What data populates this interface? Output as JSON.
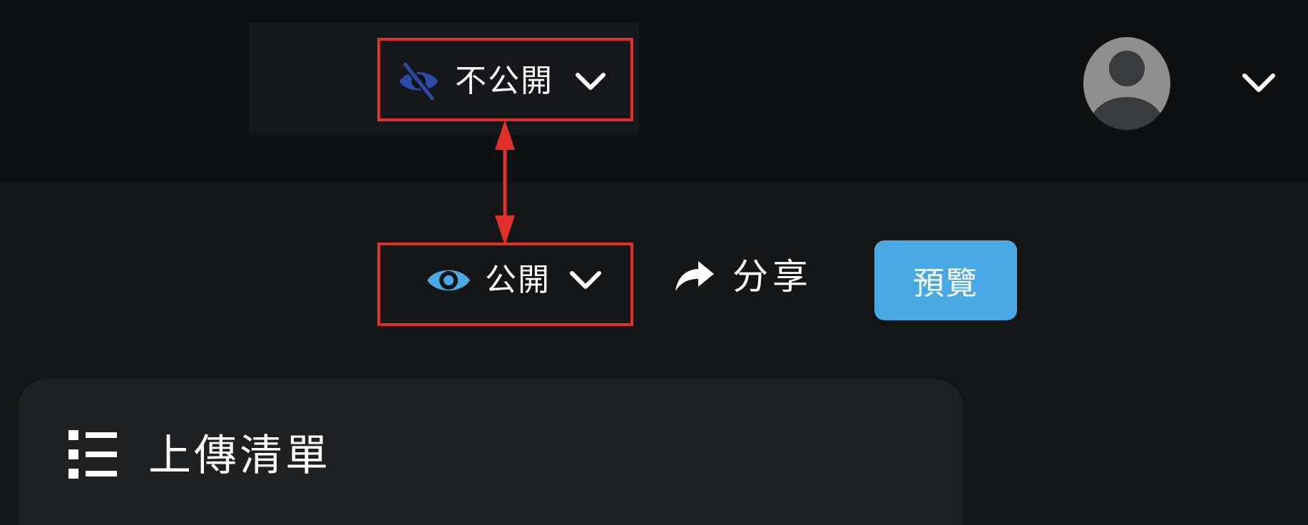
{
  "top_bar": {
    "visibility_private": {
      "label": "不公開",
      "icon": "eye-slash-icon",
      "icon_color": "#2e4aa8",
      "chevron_icon": "chevron-down-icon"
    },
    "user_menu": {
      "avatar_icon": "default-user-avatar",
      "chevron_icon": "chevron-down-icon"
    }
  },
  "toolbar": {
    "visibility_public": {
      "label": "公開",
      "icon": "eye-icon",
      "icon_color": "#4aa8e2",
      "chevron_icon": "chevron-down-icon"
    },
    "share": {
      "label": "分享",
      "icon": "share-arrow-icon"
    },
    "preview": {
      "label": "預覽",
      "color": "#4aa8e2"
    }
  },
  "upload_list": {
    "title": "上傳清單",
    "icon": "list-icon"
  },
  "annotation": {
    "color": "#e0302a",
    "meaning": "bidirectional-arrow-linking-private-and-public-toggles"
  }
}
